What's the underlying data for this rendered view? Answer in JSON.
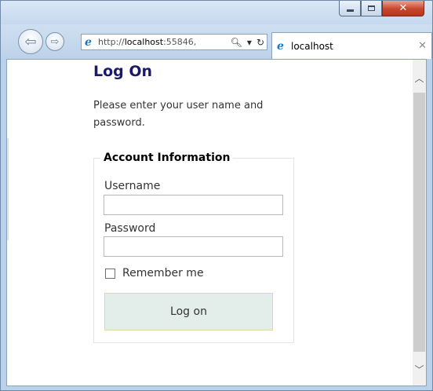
{
  "browser": {
    "url_prefix": "http://",
    "url_host": "localhost",
    "url_rest": ":55846,",
    "tab_title": "localhost",
    "icons": {
      "back": "back-arrow-icon",
      "forward": "forward-arrow-icon",
      "search": "search-icon",
      "dropdown": "chevron-down-icon",
      "refresh": "refresh-icon",
      "close": "close-icon"
    }
  },
  "page": {
    "title": "Log On",
    "instructions": "Please enter your user name and password.",
    "fieldset_legend": "Account Information",
    "username_label": "Username",
    "password_label": "Password",
    "username_value": "",
    "password_value": "",
    "remember_label": "Remember me",
    "submit_label": "Log on"
  },
  "colors": {
    "title": "#1a1a66",
    "button_bg": "#e3ede9",
    "button_border": "#e2d7a8"
  }
}
